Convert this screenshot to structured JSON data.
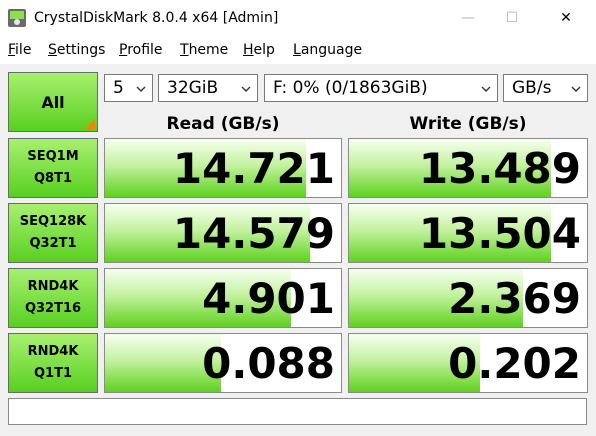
{
  "window": {
    "title": "CrystalDiskMark 8.0.4 x64 [Admin]",
    "minimize_glyph": "—",
    "maximize_glyph": "☐",
    "close_glyph": "✕",
    "icon": "disk-app-icon"
  },
  "menu": [
    {
      "label": "File",
      "accel": "F",
      "rest": "ile"
    },
    {
      "label": "Settings",
      "accel": "S",
      "rest": "ettings"
    },
    {
      "label": "Profile",
      "accel": "P",
      "rest": "rofile"
    },
    {
      "label": "Theme",
      "accel": "T",
      "rest": "heme"
    },
    {
      "label": "Help",
      "accel": "H",
      "rest": "elp"
    },
    {
      "label": "Language",
      "accel": "L",
      "rest": "anguage"
    }
  ],
  "controls": {
    "all_label": "All",
    "count": "5",
    "size": "32GiB",
    "drive": "F: 0% (0/1863GiB)",
    "unit": "GB/s"
  },
  "headers": {
    "read": "Read (GB/s)",
    "write": "Write (GB/s)"
  },
  "tests": [
    {
      "line1": "SEQ1M",
      "line2": "Q8T1",
      "read": "14.721",
      "write": "13.489",
      "read_fill": 0.85,
      "write_fill": 0.85
    },
    {
      "line1": "SEQ128K",
      "line2": "Q32T1",
      "read": "14.579",
      "write": "13.504",
      "read_fill": 0.87,
      "write_fill": 0.85
    },
    {
      "line1": "RND4K",
      "line2": "Q32T16",
      "read": "4.901",
      "write": "2.369",
      "read_fill": 0.79,
      "write_fill": 0.73
    },
    {
      "line1": "RND4K",
      "line2": "Q1T1",
      "read": "0.088",
      "write": "0.202",
      "read_fill": 0.49,
      "write_fill": 0.55
    }
  ],
  "comment": "",
  "colors": {
    "accent_green": "#58d020",
    "corner_orange": "#ff8000"
  }
}
